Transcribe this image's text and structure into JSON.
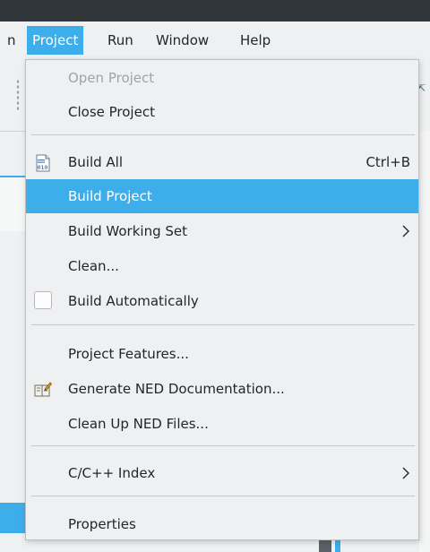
{
  "menubar": {
    "items": [
      {
        "label": "n"
      },
      {
        "label": "Project"
      },
      {
        "label": "Run"
      },
      {
        "label": "Window"
      },
      {
        "label": "Help"
      }
    ],
    "active_index": 1
  },
  "project_menu": {
    "items": [
      {
        "label": "Open Project",
        "enabled": false
      },
      {
        "label": "Close Project",
        "enabled": true
      },
      {
        "label": "Build All",
        "shortcut": "Ctrl+B",
        "icon": "binary-file-icon"
      },
      {
        "label": "Build Project",
        "highlighted": true
      },
      {
        "label": "Build Working Set",
        "submenu": true
      },
      {
        "label": "Clean..."
      },
      {
        "label": "Build Automatically",
        "checkbox": true,
        "checked": false
      },
      {
        "label": "Project Features..."
      },
      {
        "label": "Generate NED Documentation...",
        "icon": "documentation-icon"
      },
      {
        "label": "Clean Up NED Files..."
      },
      {
        "label": "C/C++ Index",
        "submenu": true
      },
      {
        "label": "Properties"
      }
    ]
  },
  "colors": {
    "highlight": "#3daee9",
    "titlebar": "#31363b",
    "menu_bg": "#eff0f1",
    "disabled_text": "#a0a4a8"
  }
}
